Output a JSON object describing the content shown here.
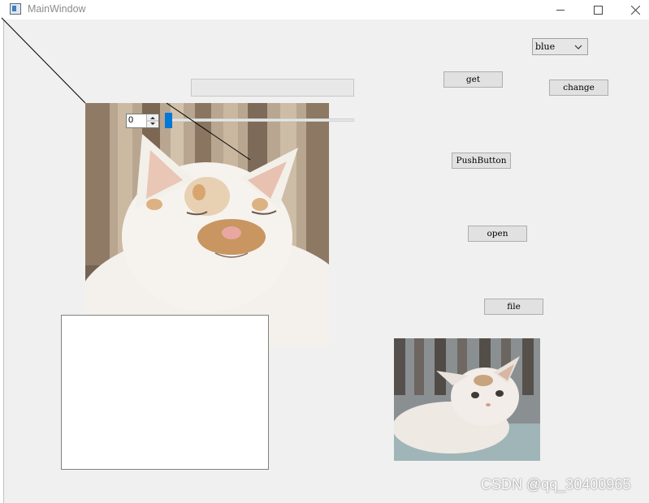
{
  "window": {
    "title": "MainWindow",
    "minimize_icon": "minimize-icon",
    "maximize_icon": "maximize-icon",
    "close_icon": "close-icon"
  },
  "buttons": {
    "get": "get",
    "change": "change",
    "push": "PushButton",
    "open": "open",
    "file": "file"
  },
  "combo": {
    "selected": "blue"
  },
  "spinbox": {
    "value": "0"
  },
  "slider": {
    "value": 0
  },
  "line_edit": {
    "value": ""
  },
  "watermark": "CSDN @qq_30400965",
  "colors": {
    "accent": "#0078d7",
    "window_bg": "#f0f0f0"
  }
}
